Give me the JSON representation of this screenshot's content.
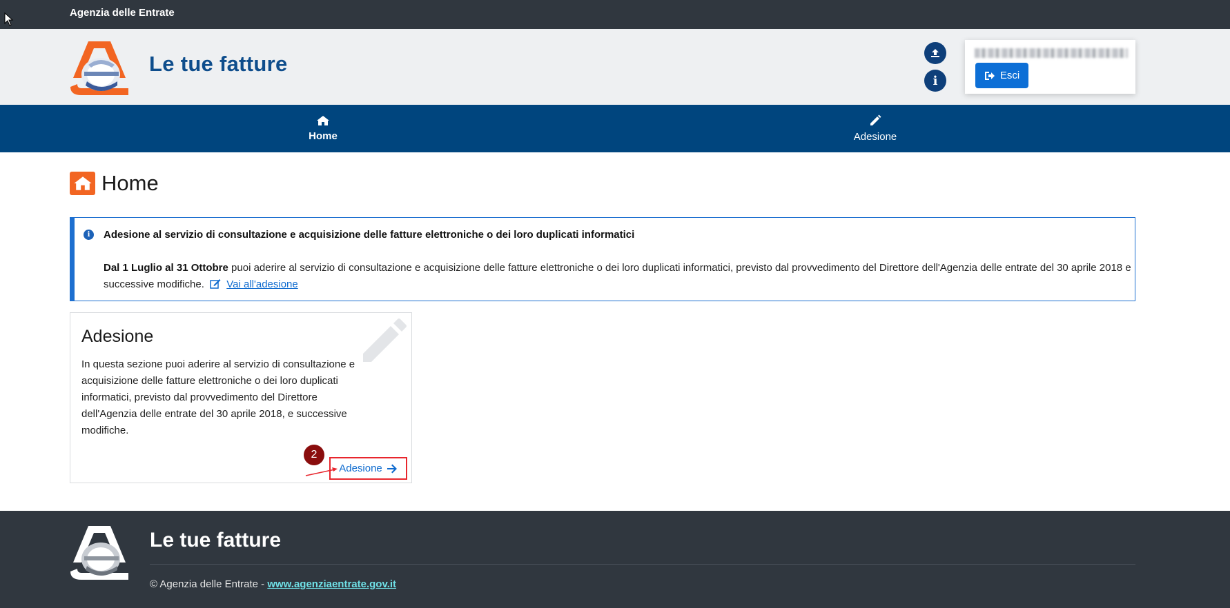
{
  "topbar": {
    "brand": "Agenzia delle Entrate"
  },
  "header": {
    "app_title": "Le tue fatture",
    "user_name_redacted": "",
    "logout_label": "Esci",
    "icons": {
      "upload": "upload-icon",
      "info": "info-icon",
      "logout": "sign-out-icon"
    }
  },
  "nav": {
    "items": [
      {
        "label": "Home",
        "icon": "home-icon",
        "active": true
      },
      {
        "label": "Adesione",
        "icon": "pencil-icon",
        "active": false
      }
    ]
  },
  "page": {
    "title": "Home",
    "title_icon": "home-icon"
  },
  "alert": {
    "title": "Adesione al servizio di consultazione e acquisizione delle fatture elettroniche o dei loro duplicati informatici",
    "body_bold": "Dal 1 Luglio al 31 Ottobre",
    "body_text": " puoi aderire al servizio di consultazione e acquisizione delle fatture elettroniche o dei loro duplicati informatici, previsto dal provvedimento del Direttore dell'Agenzia delle entrate del 30 aprile 2018 e successive modifiche.",
    "link_label": "Vai all'adesione",
    "link_icon": "edit-icon"
  },
  "card": {
    "title": "Adesione",
    "text": "In questa sezione puoi aderire al servizio di consultazione e acquisizione delle fatture elettroniche o dei loro duplicati informatici, previsto dal provvedimento del Direttore dell'Agenzia delle entrate del 30 aprile 2018, e successive modifiche.",
    "link_label": "Adesione",
    "bg_icon": "pencil-icon",
    "step_number": "2"
  },
  "footer": {
    "title": "Le tue fatture",
    "copyright": "© Agenzia delle Entrate - ",
    "link_label": "www.agenziaentrate.gov.it"
  },
  "colors": {
    "topbar": "#30373f",
    "header_bg": "#eef0f2",
    "nav_bg": "#00457e",
    "brand_blue": "#0e4d8c",
    "accent_orange": "#f26522",
    "button_blue": "#0d6fd6",
    "highlight_red": "#e8262d"
  }
}
